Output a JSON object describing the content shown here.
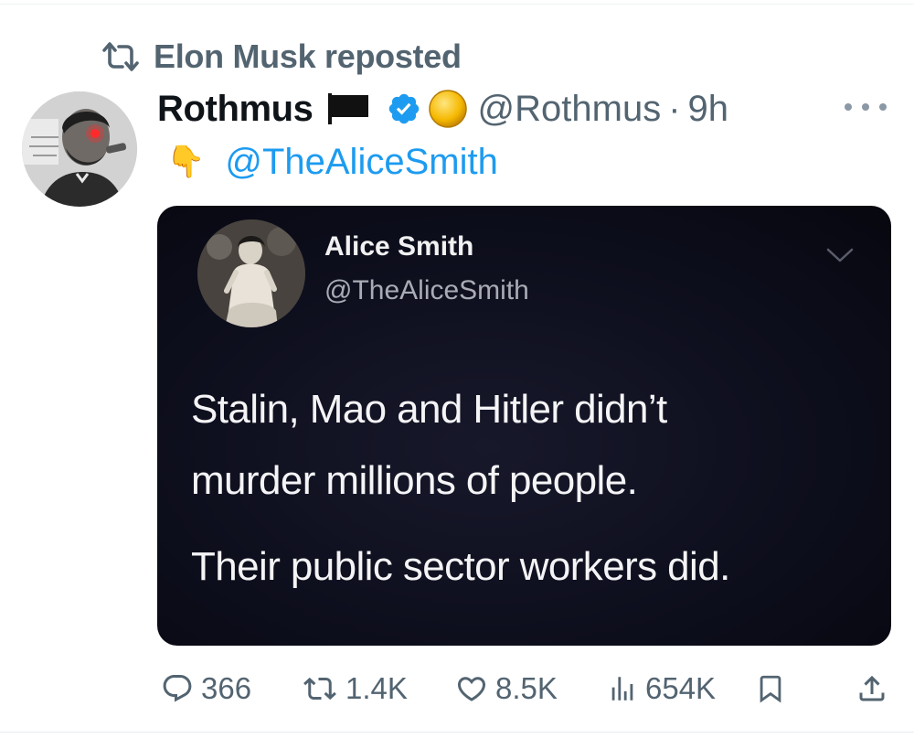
{
  "repost": {
    "label": "Elon Musk reposted",
    "icon": "repost-icon"
  },
  "tweet": {
    "author_name": "Rothmus",
    "author_handle": "@Rothmus",
    "separator": "·",
    "time": "9h",
    "badges": [
      "black-flag-icon",
      "verified-badge-icon",
      "gold-circle-icon"
    ],
    "finger_emoji": "👇",
    "mention": "@TheAliceSmith"
  },
  "embedded": {
    "name": "Alice Smith",
    "handle": "@TheAliceSmith",
    "line1": "Stalin, Mao and Hitler didn’t",
    "line2": "murder millions of people.",
    "line3": "Their public sector workers did."
  },
  "stats": {
    "replies": "366",
    "reposts": "1.4K",
    "likes": "8.5K",
    "views": "654K"
  },
  "colors": {
    "accent": "#1d9bf0",
    "muted": "#536471",
    "card_bg": "#0d0e1c"
  }
}
